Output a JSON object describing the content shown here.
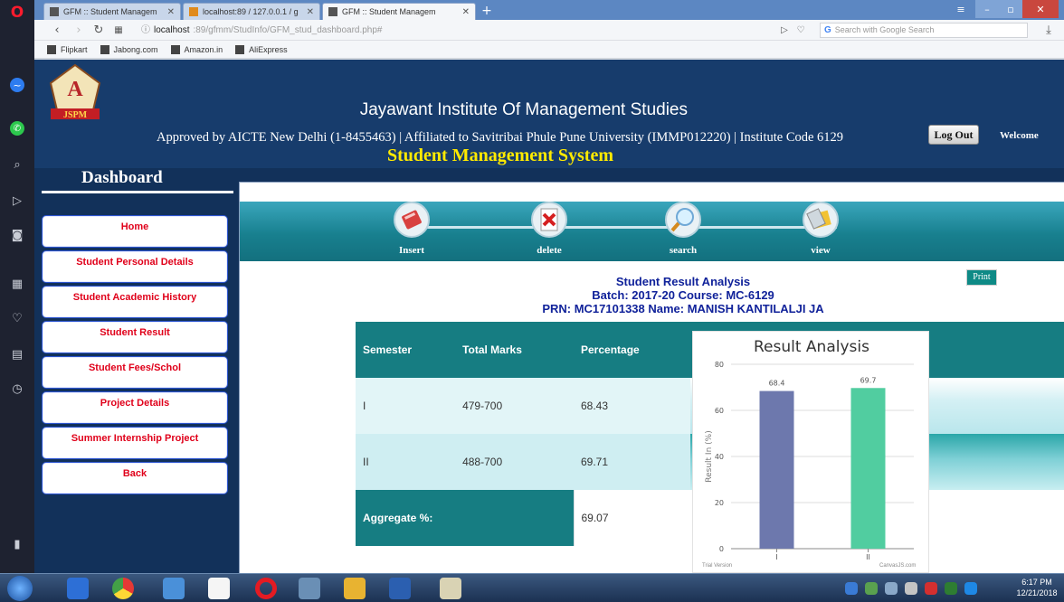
{
  "browser": {
    "tabs": [
      {
        "label": "GFM :: Student Managem"
      },
      {
        "label": "localhost:89 / 127.0.0.1 / g"
      },
      {
        "label": "GFM :: Student Managem"
      }
    ],
    "url_host": "localhost",
    "url_path": ":89/gfmm/StudInfo/GFM_stud_dashboard.php#",
    "search_placeholder": "Search with Google Search",
    "bookmarks": [
      "Flipkart",
      "Jabong.com",
      "Amazon.in",
      "AliExpress"
    ]
  },
  "header": {
    "institute": "Jayawant Institute Of Management Studies",
    "approved": "Approved by AICTE New Delhi (1-8455463) | Affiliated to Savitribai Phule Pune University (IMMP012220) | Institute Code 6129",
    "welcome": "Welcome",
    "system": "Student Management System",
    "logout": "Log Out",
    "logo_text": "JSPM"
  },
  "sidebar": {
    "title": "Dashboard",
    "items": [
      {
        "label": "Home"
      },
      {
        "label": "Student Personal Details"
      },
      {
        "label": "Student Academic History"
      },
      {
        "label": "Student Result"
      },
      {
        "label": "Student Fees/Schol"
      },
      {
        "label": "Project Details"
      },
      {
        "label": "Summer Internship Project"
      },
      {
        "label": "Back"
      }
    ]
  },
  "toolbar": {
    "buttons": [
      {
        "label": "Insert"
      },
      {
        "label": "delete"
      },
      {
        "label": "search"
      },
      {
        "label": "view"
      }
    ]
  },
  "report": {
    "print": "Print",
    "title": "Student Result Analysis",
    "batch": "Batch: 2017-20 Course: MC-6129",
    "prn": "PRN: MC17101338 Name: MANISH KANTILALJI JA"
  },
  "table": {
    "headers": [
      "Semester",
      "Total Marks",
      "Percentage"
    ],
    "rows": [
      {
        "semester": "I",
        "marks": "479-700",
        "percentage": "68.43"
      },
      {
        "semester": "II",
        "marks": "488-700",
        "percentage": "69.71"
      }
    ],
    "aggregate_label": "Aggregate %:",
    "aggregate_value": "69.07"
  },
  "chart_data": {
    "type": "bar",
    "title": "Result Analysis",
    "ylabel": "Result In (%)",
    "xlabel": "",
    "categories": [
      "I",
      "II"
    ],
    "values": [
      68.4,
      69.7
    ],
    "ylim": [
      0,
      80
    ],
    "yticks": [
      0,
      20,
      40,
      60,
      80
    ],
    "colors": [
      "#6d78ad",
      "#51cda0"
    ],
    "grid": true,
    "watermark_left": "Trial Version",
    "watermark_right": "CanvasJS.com"
  },
  "taskbar": {
    "time": "6:17 PM",
    "date": "12/21/2018"
  }
}
